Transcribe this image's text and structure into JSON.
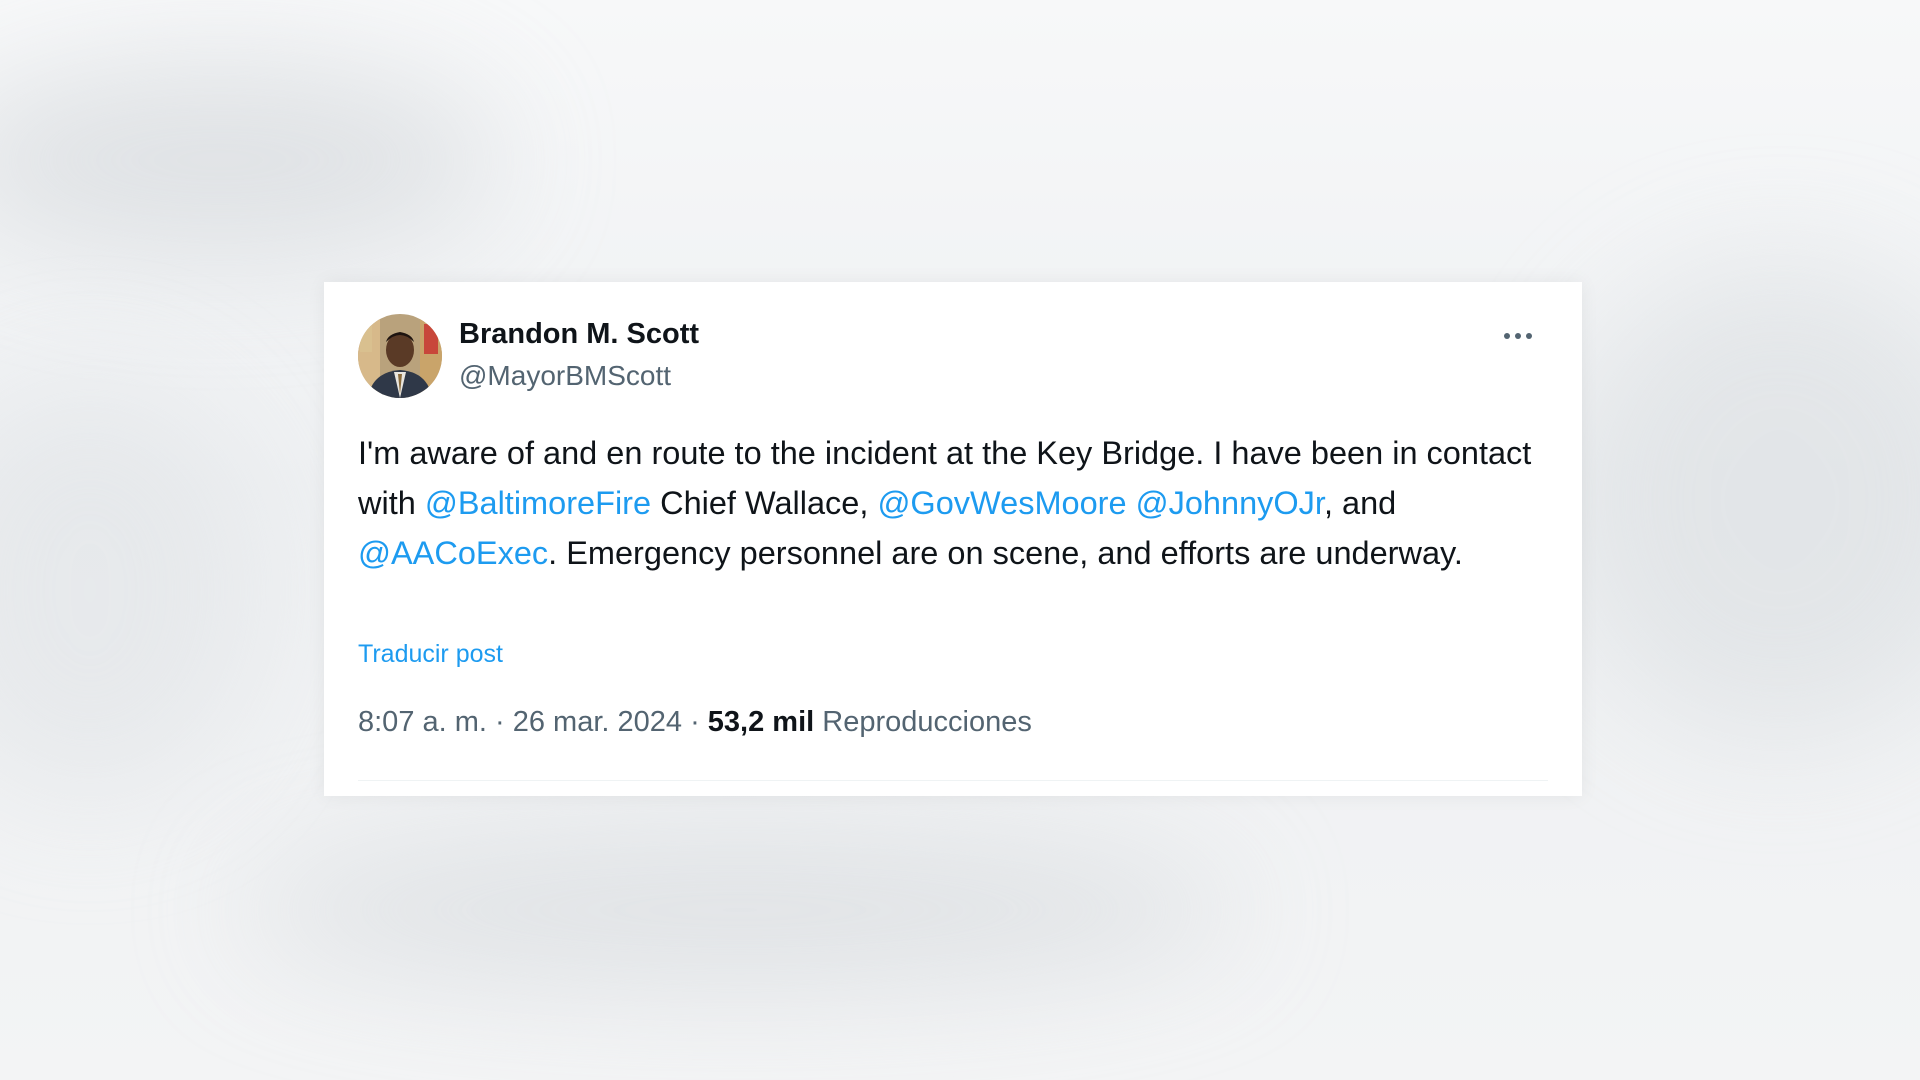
{
  "tweet": {
    "author": {
      "display_name": "Brandon M. Scott",
      "handle": "@MayorBMScott"
    },
    "more_icon": "more-horizontal-icon",
    "text_segments": {
      "t1": "I'm aware of and en route to the incident at the Key Bridge. I have been in contact with ",
      "m1": "@BaltimoreFire",
      "t2": " Chief Wallace, ",
      "m2": "@GovWesMoore",
      "t3": " ",
      "m3": "@JohnnyOJr",
      "t4": ", and ",
      "m4": "@AACoExec",
      "t5": ". Emergency personnel are on scene, and efforts are underway."
    },
    "translate_label": "Traducir post",
    "timestamp": "8:07 a. m. · 26 mar. 2024",
    "separator": " · ",
    "views_count": "53,2 mil",
    "views_label": "Reproducciones",
    "colors": {
      "link": "#1d9bf0",
      "text": "#0f1419",
      "secondary": "#536471"
    }
  }
}
